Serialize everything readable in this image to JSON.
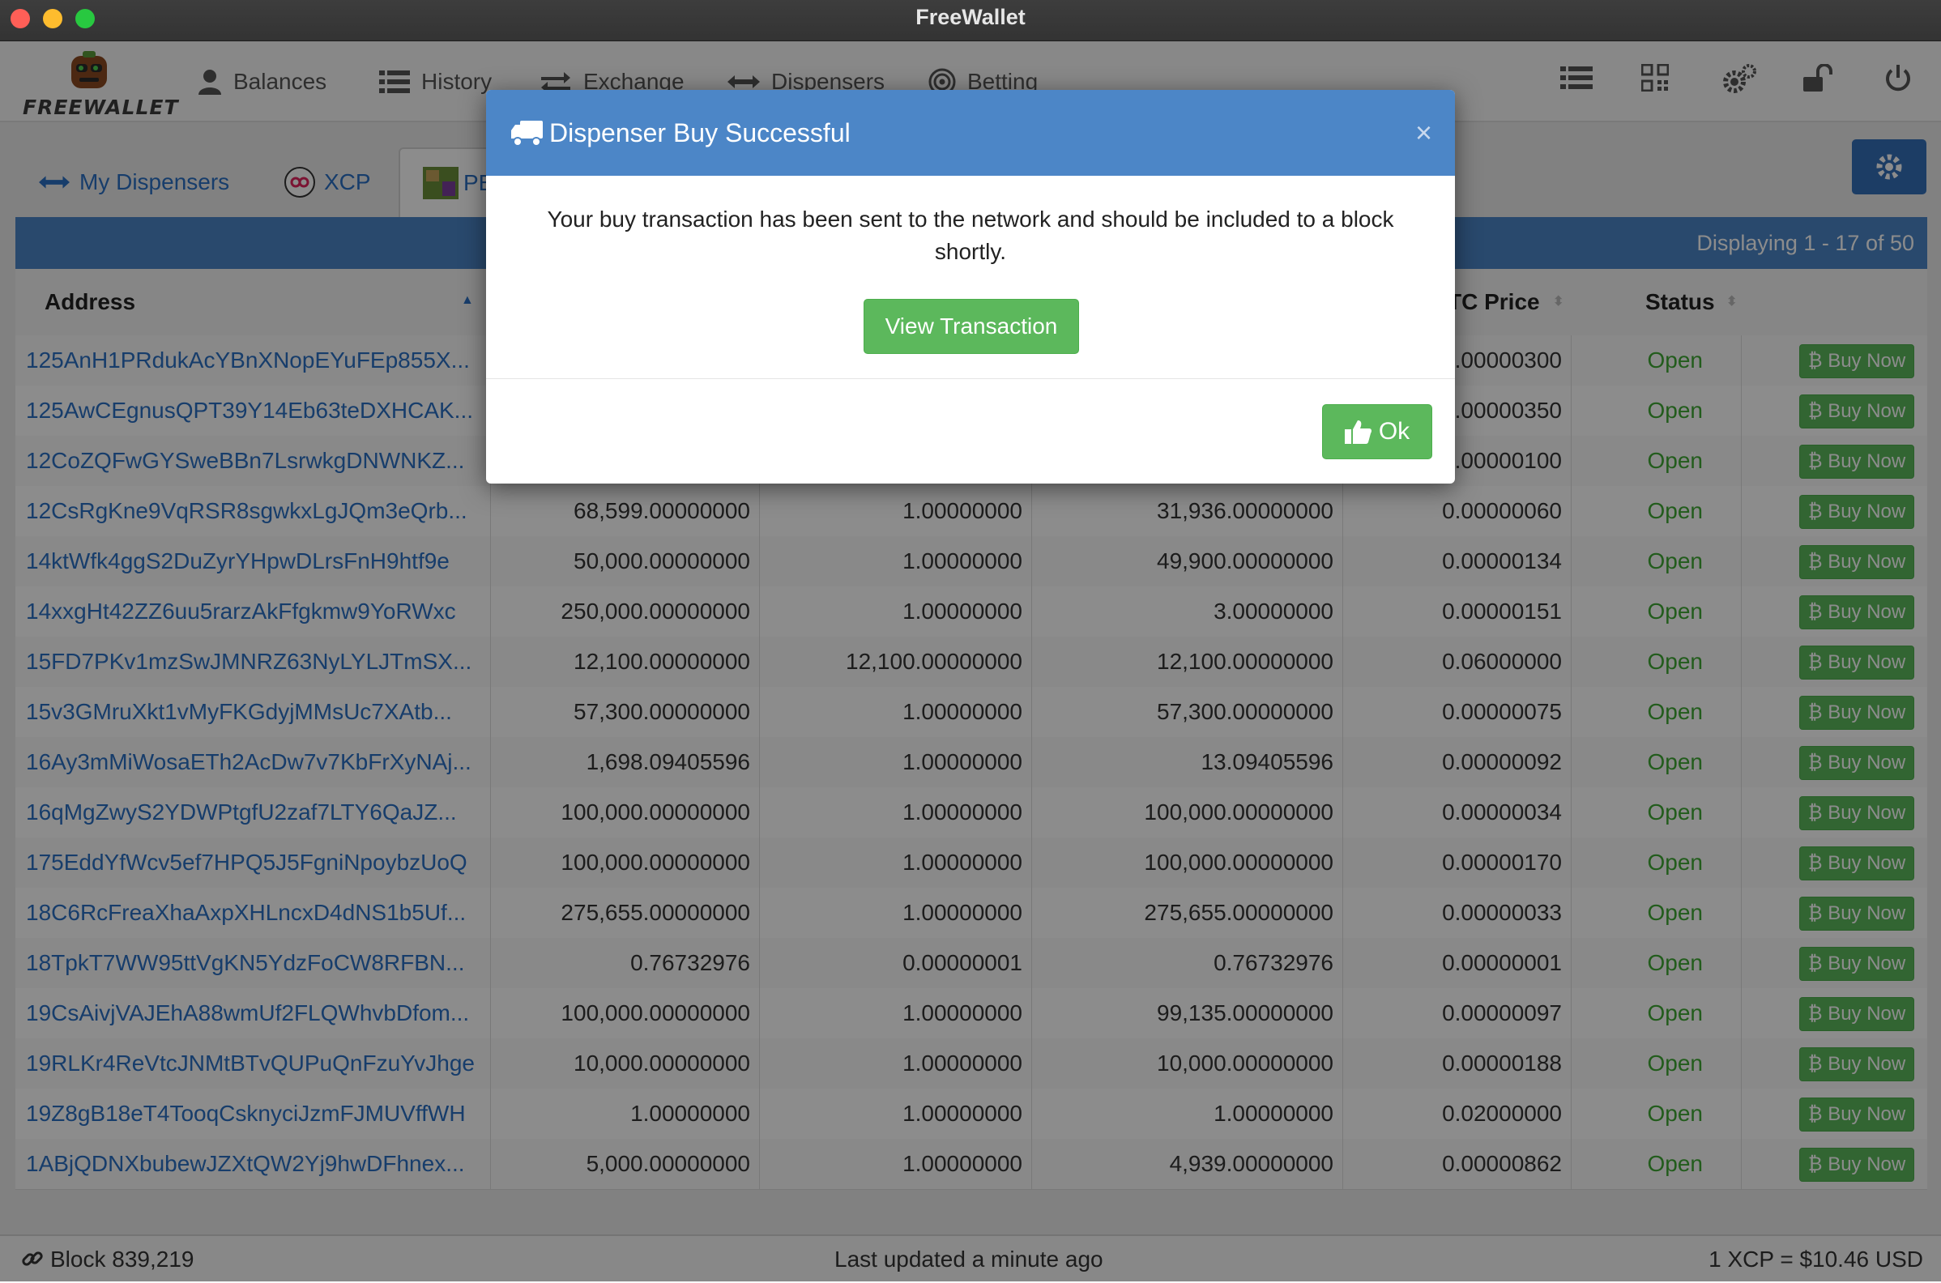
{
  "window": {
    "title": "FreeWallet"
  },
  "logo": {
    "text": "FREEWALLET"
  },
  "nav": {
    "items": [
      {
        "label": "Balances",
        "icon": "user-icon"
      },
      {
        "label": "History",
        "icon": "list-icon"
      },
      {
        "label": "Exchange",
        "icon": "exchange-icon"
      },
      {
        "label": "Dispensers",
        "icon": "arrows-horizontal-icon"
      },
      {
        "label": "Betting",
        "icon": "target-icon"
      }
    ],
    "right_icons": [
      "list-icon",
      "qrcode-icon",
      "gears-icon",
      "unlock-icon",
      "power-icon"
    ]
  },
  "tabs": [
    {
      "label": "My Dispensers",
      "icon": "arrows-horizontal-icon"
    },
    {
      "label": "XCP",
      "icon": "xcp-token-icon"
    },
    {
      "label": "PE",
      "icon": "pepe-token-icon"
    }
  ],
  "table": {
    "displaying": "Displaying 1 - 17 of 50",
    "headers": {
      "address": "Address",
      "price": "TC Price",
      "status": "Status"
    },
    "buy_label": "Buy Now",
    "rows": [
      {
        "address": "125AnH1PRdukAcYBnXNopEYuFEp855X...",
        "n1": "",
        "n2": "",
        "n3": "",
        "price": ".00000300",
        "status": "Open"
      },
      {
        "address": "125AwCEgnusQPT39Y14Eb63teDXHCAK...",
        "n1": "",
        "n2": "",
        "n3": "",
        "price": ".00000350",
        "status": "Open"
      },
      {
        "address": "12CoZQFwGYSweBBn7LsrwkgDNWNKZ...",
        "n1": "",
        "n2": "",
        "n3": "",
        "price": ".00000100",
        "status": "Open"
      },
      {
        "address": "12CsRgKne9VqRSR8sgwkxLgJQm3eQrb...",
        "n1": "68,599.00000000",
        "n2": "1.00000000",
        "n3": "31,936.00000000",
        "price": "0.00000060",
        "status": "Open"
      },
      {
        "address": "14ktWfk4ggS2DuZyrYHpwDLrsFnH9htf9e",
        "n1": "50,000.00000000",
        "n2": "1.00000000",
        "n3": "49,900.00000000",
        "price": "0.00000134",
        "status": "Open"
      },
      {
        "address": "14xxgHt42ZZ6uu5rarzAkFfgkmw9YoRWxc",
        "n1": "250,000.00000000",
        "n2": "1.00000000",
        "n3": "3.00000000",
        "price": "0.00000151",
        "status": "Open"
      },
      {
        "address": "15FD7PKv1mzSwJMNRZ63NyLYLJTmSX...",
        "n1": "12,100.00000000",
        "n2": "12,100.00000000",
        "n3": "12,100.00000000",
        "price": "0.06000000",
        "status": "Open"
      },
      {
        "address": "15v3GMruXkt1vMyFKGdyjMMsUc7XAtb...",
        "n1": "57,300.00000000",
        "n2": "1.00000000",
        "n3": "57,300.00000000",
        "price": "0.00000075",
        "status": "Open"
      },
      {
        "address": "16Ay3mMiWosaETh2AcDw7v7KbFrXyNAj...",
        "n1": "1,698.09405596",
        "n2": "1.00000000",
        "n3": "13.09405596",
        "price": "0.00000092",
        "status": "Open"
      },
      {
        "address": "16qMgZwyS2YDWPtgfU2zaf7LTY6QaJZ...",
        "n1": "100,000.00000000",
        "n2": "1.00000000",
        "n3": "100,000.00000000",
        "price": "0.00000034",
        "status": "Open"
      },
      {
        "address": "175EddYfWcv5ef7HPQ5J5FgniNpoybzUoQ",
        "n1": "100,000.00000000",
        "n2": "1.00000000",
        "n3": "100,000.00000000",
        "price": "0.00000170",
        "status": "Open"
      },
      {
        "address": "18C6RcFreaXhaAxpXHLncxD4dNS1b5Uf...",
        "n1": "275,655.00000000",
        "n2": "1.00000000",
        "n3": "275,655.00000000",
        "price": "0.00000033",
        "status": "Open"
      },
      {
        "address": "18TpkT7WW95ttVgKN5YdzFoCW8RFBN...",
        "n1": "0.76732976",
        "n2": "0.00000001",
        "n3": "0.76732976",
        "price": "0.00000001",
        "status": "Open"
      },
      {
        "address": "19CsAivjVAJEhA88wmUf2FLQWhvbDfom...",
        "n1": "100,000.00000000",
        "n2": "1.00000000",
        "n3": "99,135.00000000",
        "price": "0.00000097",
        "status": "Open"
      },
      {
        "address": "19RLKr4ReVtcJNMtBTvQUPuQnFzuYvJhge",
        "n1": "10,000.00000000",
        "n2": "1.00000000",
        "n3": "10,000.00000000",
        "price": "0.00000188",
        "status": "Open"
      },
      {
        "address": "19Z8gB18eT4TooqCsknyciJzmFJMUVffWH",
        "n1": "1.00000000",
        "n2": "1.00000000",
        "n3": "1.00000000",
        "price": "0.02000000",
        "status": "Open"
      },
      {
        "address": "1ABjQDNXbubewJZXtQW2Yj9hwDFhnex...",
        "n1": "5,000.00000000",
        "n2": "1.00000000",
        "n3": "4,939.00000000",
        "price": "0.00000862",
        "status": "Open"
      }
    ]
  },
  "statusbar": {
    "block": "Block 839,219",
    "updated": "Last updated a minute ago",
    "rate": "1 XCP = $10.46 USD"
  },
  "modal": {
    "title": "Dispenser Buy Successful",
    "close": "×",
    "message": "Your buy transaction has been sent to the network and should be included to a block shortly.",
    "view_button": "View Transaction",
    "ok_button": "Ok"
  },
  "colors": {
    "accent_blue": "#4c86c7",
    "success_green": "#5cb85c",
    "status_open": "#3fa833",
    "link_blue": "#2a6fc4"
  }
}
